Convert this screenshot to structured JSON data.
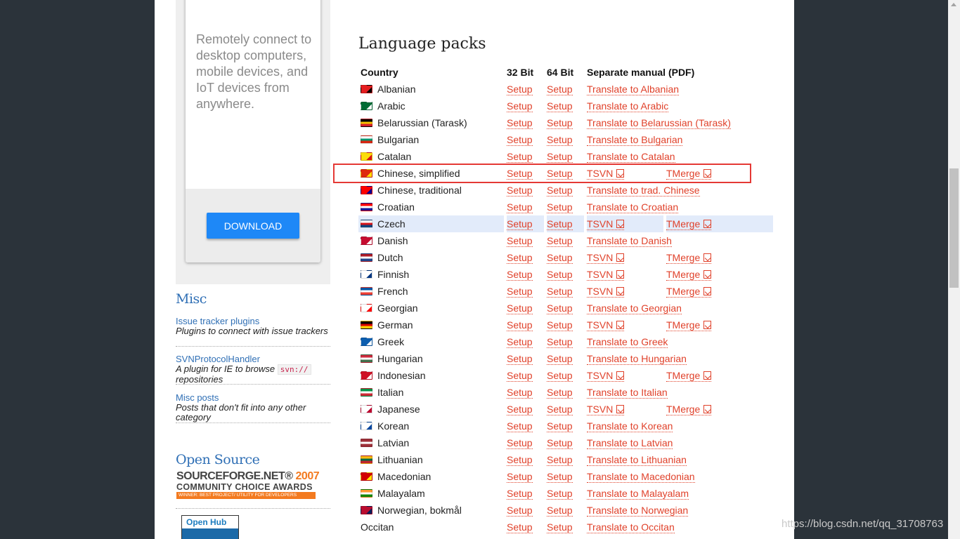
{
  "sidebar": {
    "promo_text": "Remotely connect to desktop computers, mobile devices, and IoT devices from anywhere.",
    "download_label": "DOWNLOAD",
    "misc_heading": "Misc",
    "misc_items": [
      {
        "link": "Issue tracker plugins",
        "desc": "Plugins to connect with issue trackers"
      },
      {
        "link": "SVNProtocolHandler",
        "desc_before": "A plugin for IE to browse",
        "code": "svn://",
        "desc_after": "repositories"
      },
      {
        "link": "Misc posts",
        "desc": "Posts that don't fit into any other category"
      }
    ],
    "opensource_heading": "Open Source",
    "sf_brand": "SOURCEFORGE.NET®",
    "sf_year": "2007",
    "sf_line2": "COMMUNITY CHOICE AWARDS",
    "sf_line3": "WINNER: BEST PROJECT/ UTILITY FOR DEVELOPERS",
    "openhub_label": "Open Hub"
  },
  "main": {
    "title": "Language packs",
    "headers": {
      "country": "Country",
      "bit32": "32 Bit",
      "bit64": "64 Bit",
      "manual": "Separate manual (PDF)"
    },
    "setup_label": "Setup",
    "tsvn_label": "TSVN",
    "tmerge_label": "TMerge",
    "rows": [
      {
        "country": "Albanian",
        "flag": [
          "#e41e20",
          "#000000"
        ],
        "manual": "Translate to Albanian"
      },
      {
        "country": "Arabic",
        "flag": [
          "#006c35",
          "#ffffff"
        ],
        "manual": "Translate to Arabic"
      },
      {
        "country": "Belarussian (Tarask)",
        "flag": [
          "#000000",
          "#f5c400",
          "#d4202a"
        ],
        "manual": "Translate to Belarussian (Tarask)"
      },
      {
        "country": "Bulgarian",
        "flag": [
          "#ffffff",
          "#00966e",
          "#d62612"
        ],
        "manual": "Translate to Bulgarian"
      },
      {
        "country": "Catalan",
        "flag": [
          "#fcdd09",
          "#da121a"
        ],
        "manual": "Translate to Catalan"
      },
      {
        "country": "Chinese, simplified",
        "flag": [
          "#de2910",
          "#ffde00"
        ],
        "manual": null
      },
      {
        "country": "Chinese, traditional",
        "flag": [
          "#fe0000",
          "#000095"
        ],
        "manual": "Translate to trad. Chinese"
      },
      {
        "country": "Croatian",
        "flag": [
          "#ff0000",
          "#ffffff",
          "#171796"
        ],
        "manual": "Translate to Croatian"
      },
      {
        "country": "Czech",
        "flag": [
          "#ffffff",
          "#d7141a",
          "#11457e"
        ],
        "manual": null,
        "highlight": true
      },
      {
        "country": "Danish",
        "flag": [
          "#c60c30",
          "#ffffff"
        ],
        "manual": "Translate to Danish"
      },
      {
        "country": "Dutch",
        "flag": [
          "#ae1c28",
          "#ffffff",
          "#21468b"
        ],
        "manual": null
      },
      {
        "country": "Finnish",
        "flag": [
          "#ffffff",
          "#003580"
        ],
        "manual": null
      },
      {
        "country": "French",
        "flag": [
          "#0055a4",
          "#ffffff",
          "#ef4135"
        ],
        "manual": null
      },
      {
        "country": "Georgian",
        "flag": [
          "#ffffff",
          "#ff0000"
        ],
        "manual": "Translate to Georgian"
      },
      {
        "country": "German",
        "flag": [
          "#000000",
          "#dd0000",
          "#ffce00"
        ],
        "manual": null
      },
      {
        "country": "Greek",
        "flag": [
          "#0d5eaf",
          "#ffffff"
        ],
        "manual": "Translate to Greek"
      },
      {
        "country": "Hungarian",
        "flag": [
          "#cd2a3e",
          "#ffffff",
          "#436f4d"
        ],
        "manual": "Translate to Hungarian"
      },
      {
        "country": "Indonesian",
        "flag": [
          "#ce1126",
          "#ffffff"
        ],
        "manual": null
      },
      {
        "country": "Italian",
        "flag": [
          "#009246",
          "#ffffff",
          "#ce2b37"
        ],
        "manual": "Translate to Italian"
      },
      {
        "country": "Japanese",
        "flag": [
          "#ffffff",
          "#bc002d"
        ],
        "manual": null
      },
      {
        "country": "Korean",
        "flag": [
          "#ffffff",
          "#0047a0"
        ],
        "manual": "Translate to Korean"
      },
      {
        "country": "Latvian",
        "flag": [
          "#9e3039",
          "#ffffff",
          "#9e3039"
        ],
        "manual": "Translate to Latvian"
      },
      {
        "country": "Lithuanian",
        "flag": [
          "#fdb913",
          "#006a44",
          "#c1272d"
        ],
        "manual": "Translate to Lithuanian"
      },
      {
        "country": "Macedonian",
        "flag": [
          "#d20000",
          "#ffe600"
        ],
        "manual": "Translate to Macedonian"
      },
      {
        "country": "Malayalam",
        "flag": [
          "#ff9933",
          "#ffffff",
          "#138808"
        ],
        "manual": "Translate to Malayalam"
      },
      {
        "country": "Norwegian, bokmål",
        "flag": [
          "#ba0c2f",
          "#00205b"
        ],
        "manual": "Translate to Norwegian"
      },
      {
        "country": "Occitan",
        "flag": null,
        "manual": "Translate to Occitan"
      }
    ]
  },
  "watermark": "https://blog.csdn.net/qq_31708763"
}
